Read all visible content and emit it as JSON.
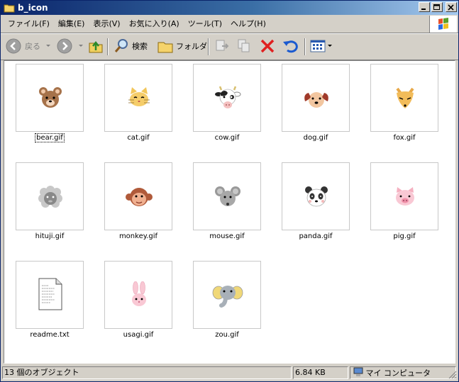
{
  "window": {
    "title": "b_icon"
  },
  "menu": [
    "ファイル(F)",
    "編集(E)",
    "表示(V)",
    "お気に入り(A)",
    "ツール(T)",
    "ヘルプ(H)"
  ],
  "toolbar": {
    "back_label": "戻る",
    "search_label": "検索",
    "folder_label": "フォルダ"
  },
  "files": [
    {
      "name": "bear.gif",
      "icon": "bear-icon"
    },
    {
      "name": "cat.gif",
      "icon": "cat-icon"
    },
    {
      "name": "cow.gif",
      "icon": "cow-icon"
    },
    {
      "name": "dog.gif",
      "icon": "dog-icon"
    },
    {
      "name": "fox.gif",
      "icon": "fox-icon"
    },
    {
      "name": "hituji.gif",
      "icon": "sheep-icon"
    },
    {
      "name": "monkey.gif",
      "icon": "monkey-icon"
    },
    {
      "name": "mouse.gif",
      "icon": "mouse-icon"
    },
    {
      "name": "panda.gif",
      "icon": "panda-icon"
    },
    {
      "name": "pig.gif",
      "icon": "pig-icon"
    },
    {
      "name": "readme.txt",
      "icon": "text-file-icon"
    },
    {
      "name": "usagi.gif",
      "icon": "rabbit-icon"
    },
    {
      "name": "zou.gif",
      "icon": "elephant-icon"
    }
  ],
  "selected_file": "bear.gif",
  "status": {
    "objects": "13 個のオブジェクト",
    "size": "6.84 KB",
    "location": "マイ コンピュータ"
  }
}
